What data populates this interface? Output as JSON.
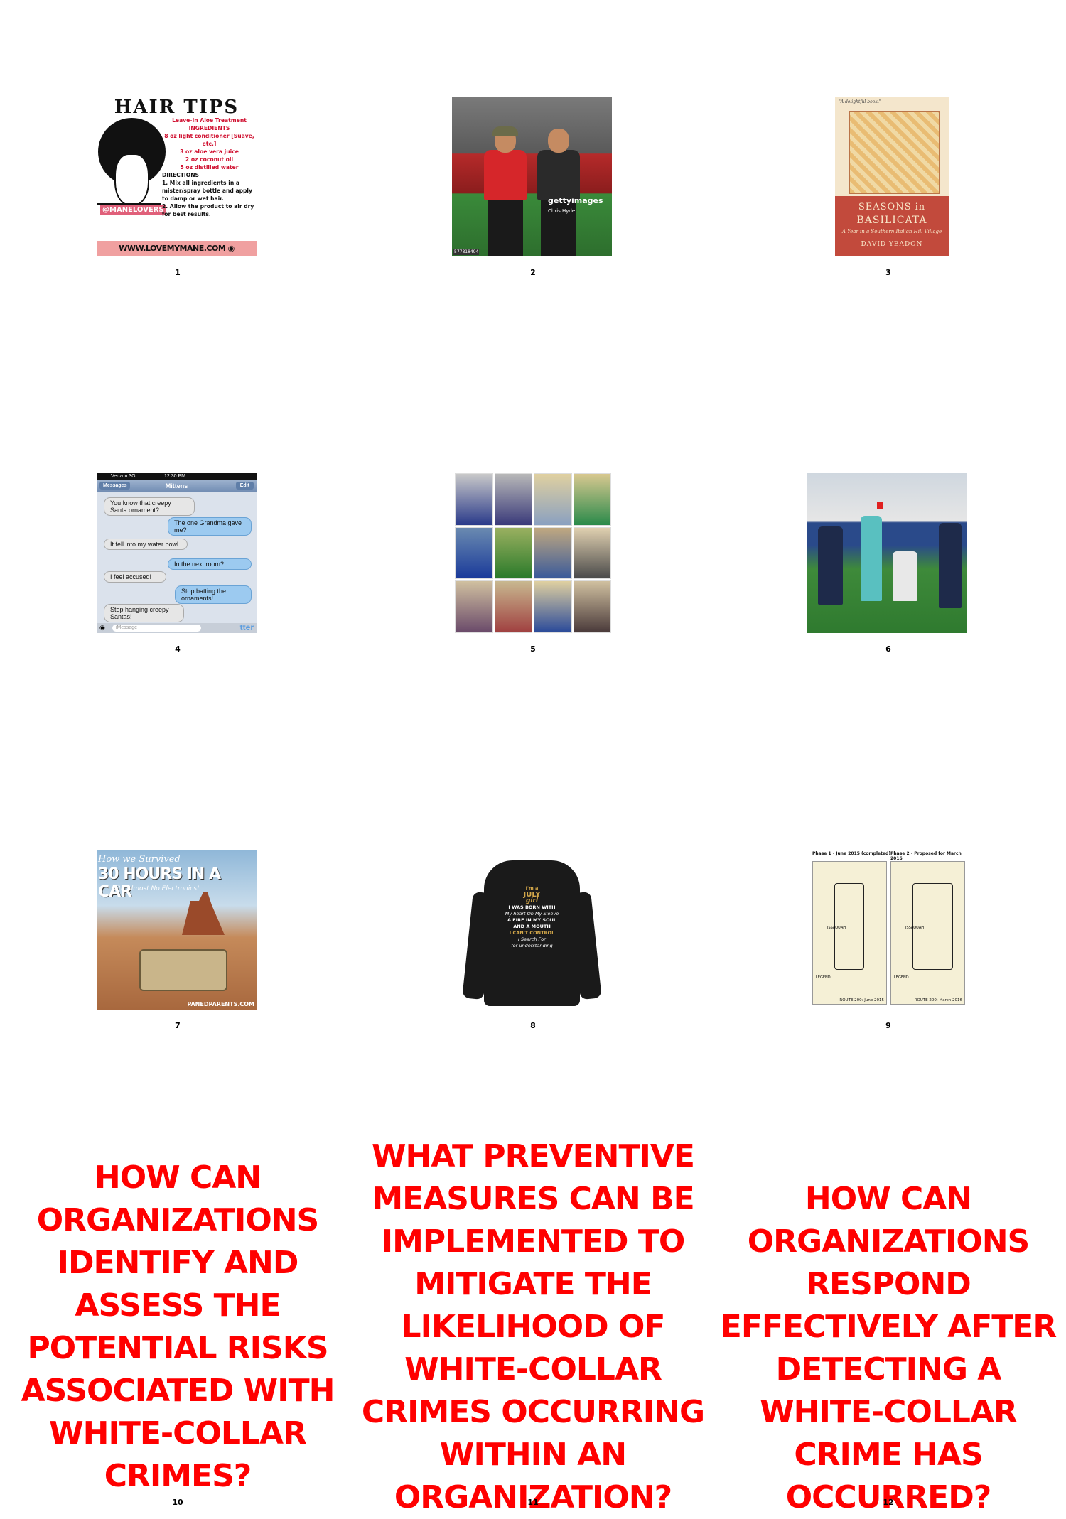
{
  "cells": [
    {
      "number": "1",
      "hair": {
        "title": "HAIR TIPS",
        "subtitle": "Leave-In Aloe Treatment",
        "ingredients_label": "INGREDIENTS",
        "ingredients": [
          "8 oz light conditioner [Suave, etc.]",
          "3 oz aloe vera juice",
          "2 oz coconut oil",
          "5 oz distilled water"
        ],
        "directions_label": "DIRECTIONS",
        "directions": [
          "1. Mix all ingredients in a mister/spray bottle and apply to damp or wet hair.",
          "2. Allow the product to air dry for best results."
        ],
        "badge": "@MANELOVERS",
        "footer": "WWW.LOVEMYMANE.COM ◉ @MANELOVERS"
      }
    },
    {
      "number": "2",
      "stadium": {
        "watermark": "gettyimages",
        "credit": "Chris Hyde",
        "tag": "577818494"
      }
    },
    {
      "number": "3",
      "book": {
        "blurb": "\"A delightful book.\"",
        "title_line1": "SEASONS in",
        "title_line2": "BASILICATA",
        "subtitle": "A Year in a Southern Italian Hill Village",
        "author": "DAVID YEADON"
      }
    },
    {
      "number": "4",
      "messages": {
        "carrier": "Verizon  3G",
        "time": "12:30 PM",
        "back_label": "Messages",
        "contact": "Mittens",
        "edit_label": "Edit",
        "bubbles": [
          {
            "dir": "in",
            "text": "You know that creepy Santa ornament?"
          },
          {
            "dir": "out",
            "text": "The one Grandma gave me?"
          },
          {
            "dir": "in",
            "text": "It fell into my water bowl."
          },
          {
            "dir": "out",
            "text": "In the next room?"
          },
          {
            "dir": "in",
            "text": "I feel accused!"
          },
          {
            "dir": "out",
            "text": "Stop batting the ornaments!"
          },
          {
            "dir": "in",
            "text": "Stop hanging creepy Santas!"
          }
        ],
        "input_placeholder": "iMessage",
        "send_label": "tter"
      }
    },
    {
      "number": "5"
    },
    {
      "number": "6"
    },
    {
      "number": "7",
      "car": {
        "line1": "How we Survived",
        "line2": "30 HOURS IN A CAR",
        "line3": "...with Almost No Electronics!",
        "watermark": "PANEDPARENTS.COM"
      }
    },
    {
      "number": "8",
      "hoodie": {
        "lines": [
          "I'm a",
          "JULY",
          "girl",
          "I WAS BORN WITH",
          "My heart On My Sleeve",
          "A FIRE IN MY SOUL",
          "AND A MOUTH",
          "I CAN'T CONTROL",
          "I Search For",
          "for understanding"
        ]
      }
    },
    {
      "number": "9",
      "map": {
        "left_caption": "Phase 1 - June 2015 (completed)",
        "right_caption": "Phase 2 - Proposed for March 2016",
        "left_label": "ISSAQUAH",
        "right_label": "ISSAQUAH",
        "legend": "LEGEND",
        "left_footer": "ROUTE 200: June 2015",
        "right_footer": "ROUTE 200: March 2016"
      }
    },
    {
      "number": "10",
      "question": "HOW CAN ORGANIZATIONS IDENTIFY AND ASSESS THE POTENTIAL RISKS ASSOCIATED WITH WHITE-COLLAR CRIMES?"
    },
    {
      "number": "11",
      "question": "WHAT PREVENTIVE MEASURES CAN BE IMPLEMENTED TO MITIGATE THE LIKELIHOOD OF WHITE-COLLAR CRIMES OCCURRING WITHIN AN ORGANIZATION?"
    },
    {
      "number": "12",
      "question": "HOW CAN ORGANIZATIONS RESPOND EFFECTIVELY AFTER DETECTING A WHITE-COLLAR CRIME HAS OCCURRED?"
    }
  ],
  "colors": {
    "question_red": "#ff0000"
  }
}
